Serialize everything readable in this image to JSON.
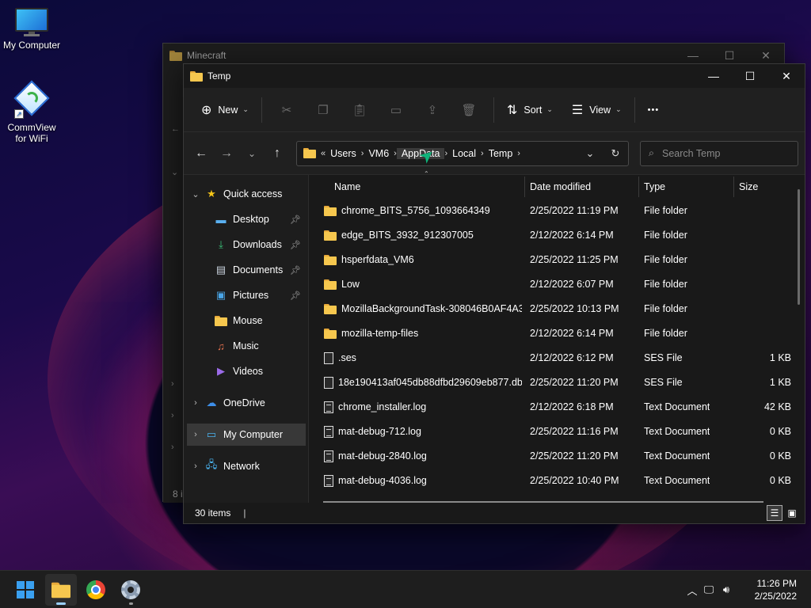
{
  "desktop": {
    "icons": [
      {
        "label": "My Computer",
        "icon": "monitor-icon"
      },
      {
        "label_line1": "CommView",
        "label_line2": "for WiFi",
        "icon": "commview-icon"
      }
    ]
  },
  "back_window": {
    "title": "Minecraft",
    "status_partial": "8 i"
  },
  "window": {
    "title": "Temp",
    "controls": {
      "minimize": "—",
      "maximize": "☐",
      "close": "✕"
    }
  },
  "toolbar": {
    "new_label": "New",
    "sort_label": "Sort",
    "view_label": "View",
    "more_label": "•••"
  },
  "address": {
    "crumbs": [
      "Users",
      "VM6",
      "AppData",
      "Local",
      "Temp"
    ],
    "overflow": "«",
    "search_placeholder": "Search Temp"
  },
  "navpane": {
    "quick_access": "Quick access",
    "items": [
      {
        "label": "Desktop",
        "icon": "desktop-icon",
        "pinned": true
      },
      {
        "label": "Downloads",
        "icon": "downloads-icon",
        "pinned": true
      },
      {
        "label": "Documents",
        "icon": "documents-icon",
        "pinned": true
      },
      {
        "label": "Pictures",
        "icon": "pictures-icon",
        "pinned": true
      },
      {
        "label": "Mouse",
        "icon": "folder-icon",
        "pinned": false
      },
      {
        "label": "Music",
        "icon": "music-icon",
        "pinned": false
      },
      {
        "label": "Videos",
        "icon": "videos-icon",
        "pinned": false
      }
    ],
    "onedrive": "OneDrive",
    "my_computer": "My Computer",
    "network": "Network"
  },
  "columns": {
    "name": "Name",
    "date": "Date modified",
    "type": "Type",
    "size": "Size"
  },
  "files": [
    {
      "name": "chrome_BITS_5756_1093664349",
      "date": "2/25/2022 11:19 PM",
      "type": "File folder",
      "size": "",
      "kind": "folder"
    },
    {
      "name": "edge_BITS_3932_912307005",
      "date": "2/12/2022 6:14 PM",
      "type": "File folder",
      "size": "",
      "kind": "folder"
    },
    {
      "name": "hsperfdata_VM6",
      "date": "2/25/2022 11:25 PM",
      "type": "File folder",
      "size": "",
      "kind": "folder"
    },
    {
      "name": "Low",
      "date": "2/12/2022 6:07 PM",
      "type": "File folder",
      "size": "",
      "kind": "folder"
    },
    {
      "name": "MozillaBackgroundTask-308046B0AF4A3...",
      "date": "2/25/2022 10:13 PM",
      "type": "File folder",
      "size": "",
      "kind": "folder"
    },
    {
      "name": "mozilla-temp-files",
      "date": "2/12/2022 6:14 PM",
      "type": "File folder",
      "size": "",
      "kind": "folder"
    },
    {
      "name": ".ses",
      "date": "2/12/2022 6:12 PM",
      "type": "SES File",
      "size": "1 KB",
      "kind": "file"
    },
    {
      "name": "18e190413af045db88dfbd29609eb877.db....",
      "date": "2/25/2022 11:20 PM",
      "type": "SES File",
      "size": "1 KB",
      "kind": "file"
    },
    {
      "name": "chrome_installer.log",
      "date": "2/12/2022 6:18 PM",
      "type": "Text Document",
      "size": "42 KB",
      "kind": "doc"
    },
    {
      "name": "mat-debug-712.log",
      "date": "2/25/2022 11:16 PM",
      "type": "Text Document",
      "size": "0 KB",
      "kind": "doc"
    },
    {
      "name": "mat-debug-2840.log",
      "date": "2/25/2022 11:20 PM",
      "type": "Text Document",
      "size": "0 KB",
      "kind": "doc"
    },
    {
      "name": "mat-debug-4036.log",
      "date": "2/25/2022 10:40 PM",
      "type": "Text Document",
      "size": "0 KB",
      "kind": "doc"
    }
  ],
  "status": {
    "item_count": "30 items",
    "separator": "|"
  },
  "taskbar": {
    "time": "11:26 PM",
    "date": "2/25/2022",
    "apps": [
      "start-icon",
      "file-explorer-icon",
      "chrome-icon",
      "settings-icon"
    ]
  },
  "colors": {
    "folder": "#f6c74e",
    "accent": "#3aa0f0",
    "window_bg": "#191919"
  }
}
